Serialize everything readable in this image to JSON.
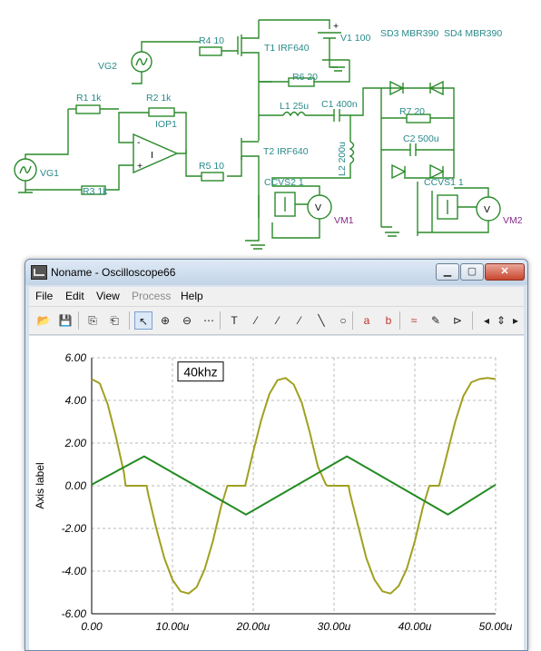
{
  "schematic": {
    "labels": {
      "r4": "R4 10",
      "t1": "T1 IRF640",
      "v1": "V1 100",
      "sd3": "SD3 MBR390",
      "sd4": "SD4 MBR390",
      "vg2": "VG2",
      "r6": "R6 20",
      "r1": "R1 1k",
      "r2": "R2 1k",
      "iop1": "IOP1",
      "l1": "L1 25u",
      "c1": "C1 400n",
      "r7": "R7 20",
      "c2": "C2 500u",
      "vg1": "VG1",
      "r5": "R5 10",
      "t2": "T2 IRF640",
      "l2": "L2 200u",
      "r3": "R3 1k",
      "ccvs2": "CCVS2 1",
      "ccvs1": "CCVS1 1",
      "vm1": "VM1",
      "vm2": "VM2",
      "opamp_symbol": "I",
      "voltmeter_symbol": "V",
      "plus": "+",
      "minus": "-"
    }
  },
  "window": {
    "title": "Noname - Oscilloscope66",
    "minimize": "▁",
    "maximize": "▢",
    "close": "✕"
  },
  "menu": [
    "File",
    "Edit",
    "View",
    "Process",
    "Help"
  ],
  "toolbar": {
    "icons": [
      "open-folder-icon",
      "save-icon",
      "copy-icon",
      "paste-icon",
      "pointer-icon",
      "zoom-in-icon",
      "zoom-out-icon",
      "grid-icon",
      "text-icon",
      "curve-label-icon",
      "curve-label2-icon",
      "curve-label3-icon",
      "line-icon",
      "circle-icon",
      "cursor-a-icon",
      "cursor-b-icon",
      "add-curve-icon",
      "probe-icon",
      "flag-icon",
      "arrow-left-icon",
      "arrow-updown-icon",
      "arrow-right-icon"
    ],
    "glyphs": [
      "📂",
      "💾",
      "⎘",
      "⎗",
      "↖",
      "⊕",
      "⊖",
      "⋯",
      "T",
      "⁄",
      "⁄",
      "⁄",
      "╲",
      "○",
      "a",
      "b",
      "≈",
      "✎",
      "⊳",
      "◂",
      "⇕",
      "▸"
    ]
  },
  "colors": {
    "trace_olive": "#a0a020",
    "trace_green": "#228b22",
    "grid": "#b8b8b8",
    "schematic_wire": "#2a8a2a",
    "label_teal": "#2a8a8a",
    "label_purple": "#8a2a8a"
  },
  "chart_data": {
    "type": "line",
    "annotation": "40khz",
    "ylabel": "Axis label",
    "xlabel": "",
    "xlim": [
      0,
      50
    ],
    "ylim": [
      -6,
      6
    ],
    "x_unit": "u",
    "x_ticks": [
      "0.00",
      "10.00u",
      "20.00u",
      "30.00u",
      "40.00u",
      "50.00u"
    ],
    "y_ticks": [
      "6.00",
      "4.00",
      "2.00",
      "0.00",
      "-2.00",
      "-4.00",
      "-6.00"
    ],
    "grid": true,
    "series": [
      {
        "color": "#a0a020",
        "x": [
          0,
          1,
          2,
          3,
          4,
          4.2,
          6,
          6.8,
          7,
          8,
          9,
          10,
          11,
          12,
          13,
          14,
          15,
          16,
          16.8,
          17,
          18,
          19,
          20,
          21,
          22,
          23,
          24,
          25,
          26,
          27,
          28,
          29,
          29.2,
          31,
          31.8,
          32,
          33,
          34,
          35,
          36,
          37,
          38,
          39,
          40,
          41,
          41.8,
          42,
          43,
          44,
          45,
          46,
          47,
          48,
          49,
          50
        ],
        "y": [
          5.0,
          4.8,
          3.8,
          2.3,
          0.6,
          0.0,
          0.0,
          0.0,
          -0.4,
          -2.0,
          -3.4,
          -4.4,
          -4.95,
          -5.05,
          -4.75,
          -3.9,
          -2.6,
          -1.0,
          0.0,
          0.0,
          0.0,
          0.0,
          1.6,
          3.1,
          4.3,
          4.95,
          5.05,
          4.75,
          3.9,
          2.5,
          0.9,
          0.05,
          0.0,
          0.0,
          0.0,
          -0.4,
          -1.9,
          -3.4,
          -4.4,
          -4.95,
          -5.05,
          -4.7,
          -3.9,
          -2.6,
          -1.0,
          0.0,
          0.0,
          0.0,
          1.5,
          3.0,
          4.2,
          4.85,
          5.0,
          5.05,
          5.0
        ]
      },
      {
        "color": "#228b22",
        "x": [
          0,
          6.5,
          19.1,
          31.6,
          44.1,
          50
        ],
        "y": [
          0.05,
          1.38,
          -1.35,
          1.38,
          -1.35,
          0.05
        ]
      }
    ]
  }
}
